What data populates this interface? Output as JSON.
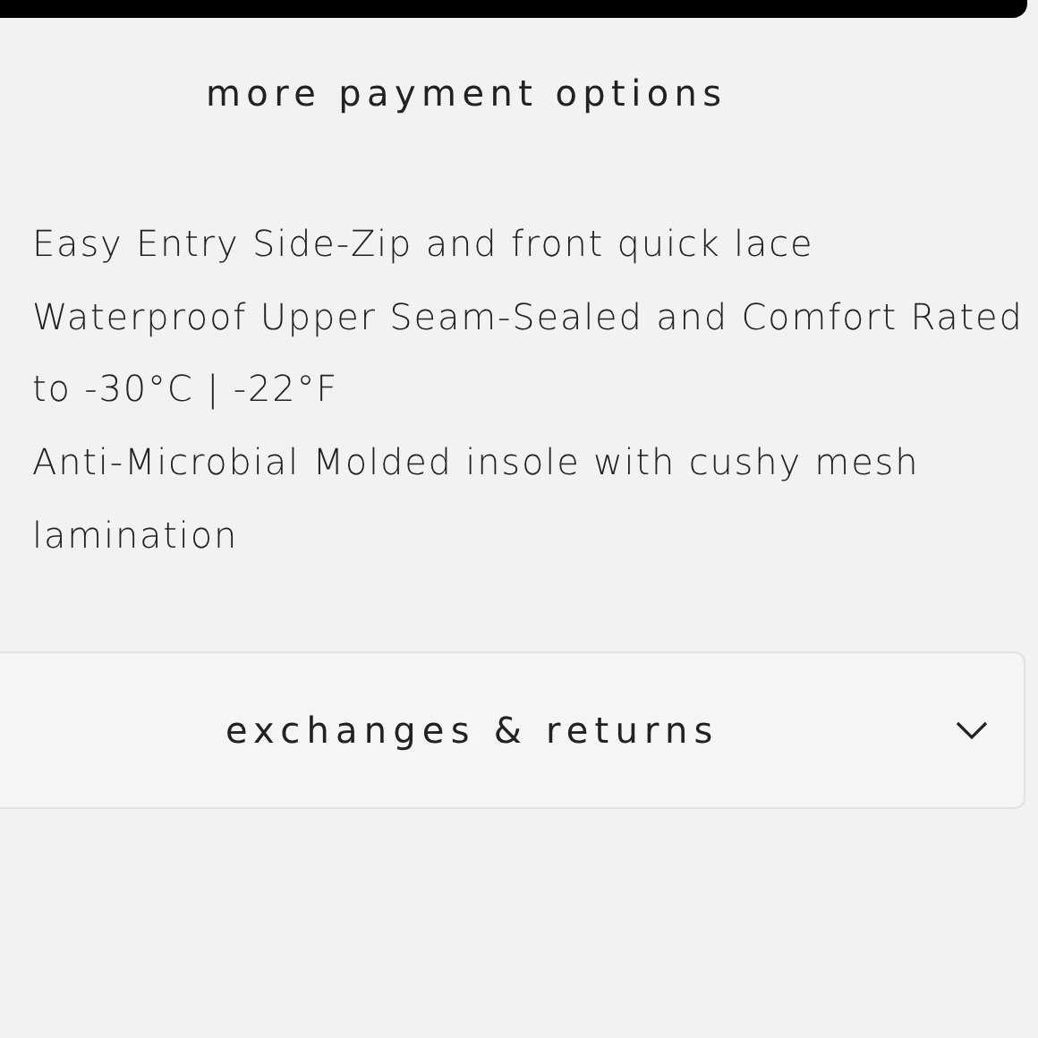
{
  "payment_link": "more payment options",
  "features": [
    "Easy Entry Side-Zip and front quick lace",
    "Waterproof Upper Seam-Sealed and Comfort Rated to -30°C | -22°F",
    "Anti-Microbial Molded insole with cushy mesh lamination"
  ],
  "accordion": {
    "title": "exchanges & returns",
    "expanded": false
  }
}
